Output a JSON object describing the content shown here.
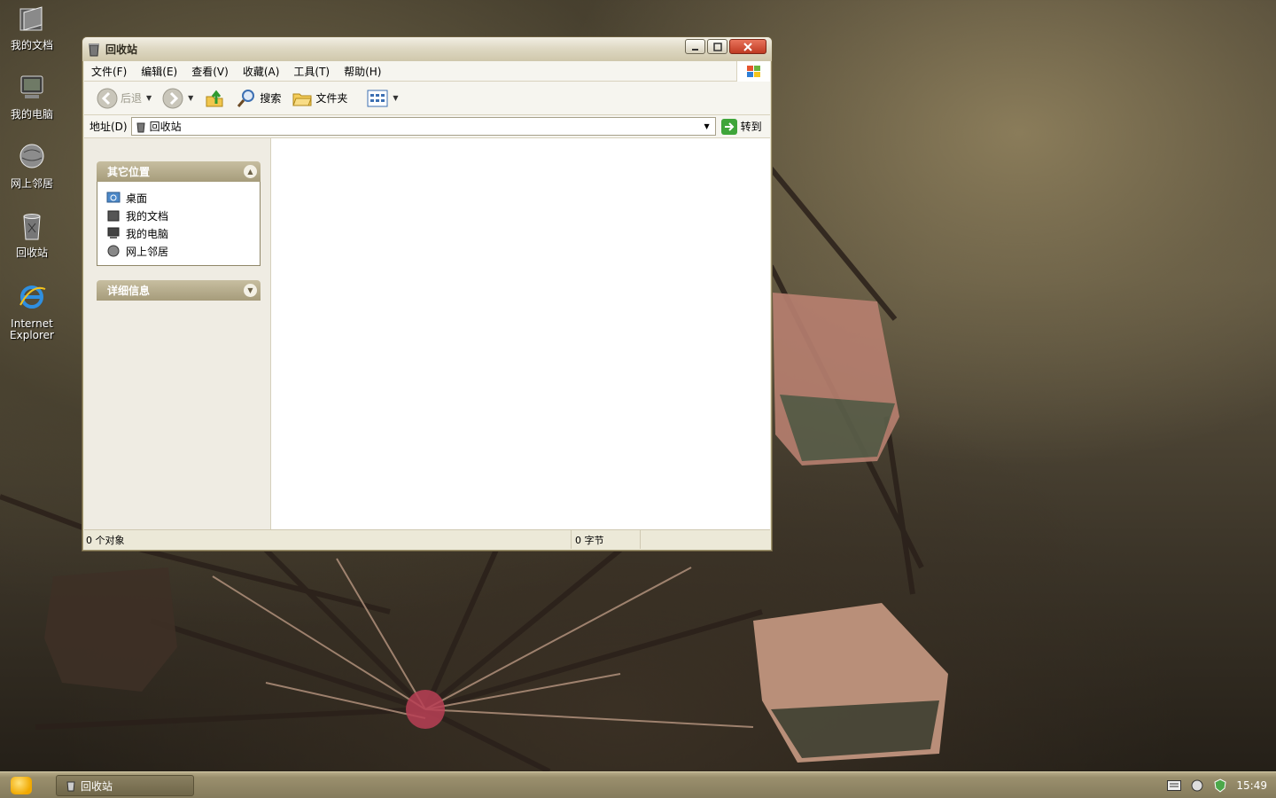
{
  "desktop": {
    "icons": [
      {
        "label": "我的文档"
      },
      {
        "label": "我的电脑"
      },
      {
        "label": "网上邻居"
      },
      {
        "label": "回收站"
      },
      {
        "label_line1": "Internet",
        "label_line2": "Explorer"
      }
    ]
  },
  "window": {
    "title": "回收站",
    "menu": [
      "文件(F)",
      "编辑(E)",
      "查看(V)",
      "收藏(A)",
      "工具(T)",
      "帮助(H)"
    ],
    "toolbar": {
      "back": "后退",
      "search": "搜索",
      "folders": "文件夹"
    },
    "address": {
      "label": "地址(D)",
      "value": "回收站",
      "go": "转到"
    },
    "taskpane": {
      "other_places": {
        "title": "其它位置",
        "links": [
          "桌面",
          "我的文档",
          "我的电脑",
          "网上邻居"
        ]
      },
      "details": {
        "title": "详细信息"
      }
    },
    "status": {
      "objects": "0 个对象",
      "size": "0 字节"
    }
  },
  "taskbar": {
    "task": "回收站",
    "clock": "15:49"
  },
  "colors": {
    "accent": "#a69c7b",
    "taskbar": "#857b5c"
  }
}
